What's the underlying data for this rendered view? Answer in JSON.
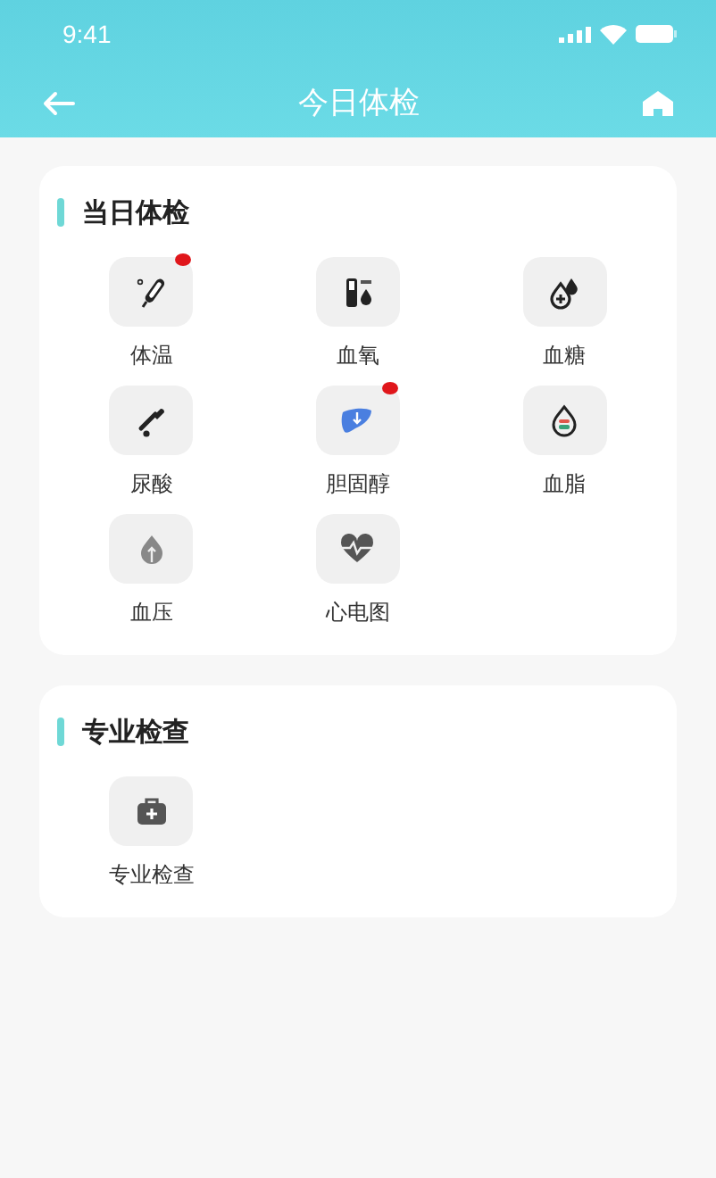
{
  "status_bar": {
    "time": "9:41"
  },
  "nav": {
    "title": "今日体检"
  },
  "sections": [
    {
      "title": "当日体检",
      "items": [
        {
          "label": "体温",
          "kind": "thermometer",
          "badge": true
        },
        {
          "label": "血氧",
          "kind": "oxygen",
          "badge": false
        },
        {
          "label": "血糖",
          "kind": "glucose",
          "badge": false
        },
        {
          "label": "尿酸",
          "kind": "dropper",
          "badge": false
        },
        {
          "label": "胆固醇",
          "kind": "liver",
          "badge": true
        },
        {
          "label": "血脂",
          "kind": "lipid",
          "badge": false
        },
        {
          "label": "血压",
          "kind": "pressure",
          "badge": false
        },
        {
          "label": "心电图",
          "kind": "heart",
          "badge": false
        }
      ]
    },
    {
      "title": "专业检查",
      "items": [
        {
          "label": "专业检查",
          "kind": "kit",
          "badge": false
        }
      ]
    }
  ]
}
